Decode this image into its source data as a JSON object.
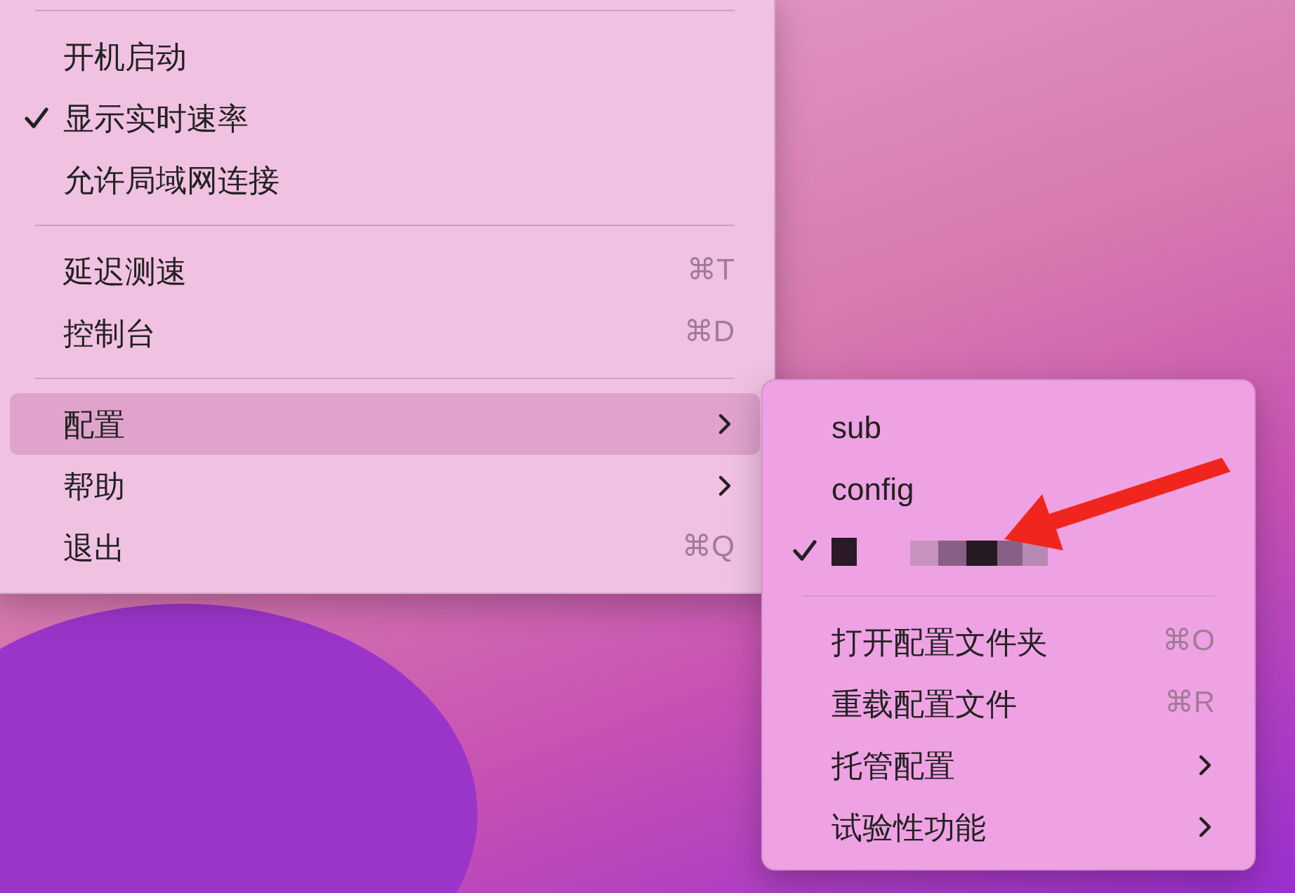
{
  "main_menu": {
    "items": [
      {
        "kind": "separator"
      },
      {
        "kind": "item",
        "label": "开机启动",
        "checked": false,
        "selected": false
      },
      {
        "kind": "item",
        "label": "显示实时速率",
        "checked": true,
        "selected": false
      },
      {
        "kind": "item",
        "label": "允许局域网连接",
        "checked": false,
        "selected": false
      },
      {
        "kind": "separator"
      },
      {
        "kind": "item",
        "label": "延迟测速",
        "checked": false,
        "selected": false,
        "shortcut": "⌘T"
      },
      {
        "kind": "item",
        "label": "控制台",
        "checked": false,
        "selected": false,
        "shortcut": "⌘D"
      },
      {
        "kind": "separator"
      },
      {
        "kind": "item",
        "label": "配置",
        "checked": false,
        "selected": true,
        "submenu": true
      },
      {
        "kind": "item",
        "label": "帮助",
        "checked": false,
        "selected": false,
        "submenu": true
      },
      {
        "kind": "item",
        "label": "退出",
        "checked": false,
        "selected": false,
        "shortcut": "⌘Q"
      }
    ]
  },
  "submenu": {
    "items": [
      {
        "kind": "item",
        "label": "sub",
        "checked": false,
        "selected": false
      },
      {
        "kind": "item",
        "label": "config",
        "checked": false,
        "selected": false
      },
      {
        "kind": "redacted",
        "checked": true,
        "selected": false
      },
      {
        "kind": "separator"
      },
      {
        "kind": "item",
        "label": "打开配置文件夹",
        "checked": false,
        "selected": false,
        "shortcut": "⌘O"
      },
      {
        "kind": "item",
        "label": "重载配置文件",
        "checked": false,
        "selected": false,
        "shortcut": "⌘R"
      },
      {
        "kind": "item",
        "label": "托管配置",
        "checked": false,
        "selected": false,
        "submenu": true
      },
      {
        "kind": "item",
        "label": "试验性功能",
        "checked": false,
        "selected": false,
        "submenu": true
      }
    ]
  }
}
